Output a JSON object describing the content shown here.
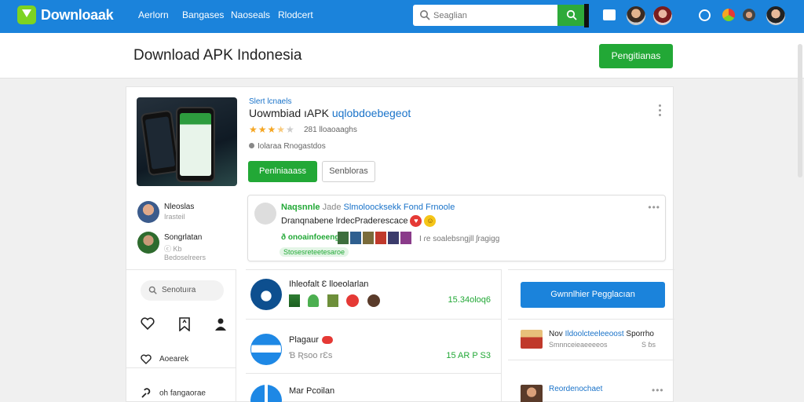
{
  "topbar": {
    "brand": "Downloaak",
    "nav": [
      "Aerlorn",
      "Bangases",
      "Naoseals",
      "Rlodcert"
    ],
    "search_placeholder": "Seaglian"
  },
  "header": {
    "title": "Download APK Indonesia",
    "button": "Pengitianas"
  },
  "app": {
    "category": "Slert lcnaels",
    "title_plain": "Uowmbiad ıAPK ",
    "title_link": "uqlobdoebegeot",
    "rating_stars": 3.5,
    "rating_text": "281 lloaoaaghs",
    "meta": "Iolaraa Rnogastdos",
    "primary_button": "Penlniaaass",
    "secondary_button": "Senbloras"
  },
  "users": [
    {
      "name": "Nleoslas",
      "sub": "Irasteil"
    },
    {
      "name": "Songrlatan",
      "sub": "ⓒ Kb",
      "sub2": "Bedoselreers"
    }
  ],
  "comment": {
    "author": "Naqsnnle",
    "separator": "Jade",
    "link": "Slmoloocksekk Fond Frnoole",
    "text": "Dranqnabene lrdecPraderescace",
    "tag": "ð onoainfoeeng",
    "tag_right": "Ι ɾe soalebsngjll ʃragigg",
    "pill": "Stosesreteetesaroe"
  },
  "left_panel": {
    "search_label": "Senotuıra",
    "link1": "Aoearek",
    "link2": "oh fangaorae"
  },
  "list": [
    {
      "title": "Ihleofalt Ɛ lloeolarlan",
      "size": "15.34oloq6"
    },
    {
      "title": "Plagaur",
      "sub": "Ɓ Ʀsoo rƐs",
      "size": "15 AR P S3"
    },
    {
      "title": "Mar Pcoilan"
    }
  ],
  "right_panel": {
    "button": "Gwnnlhier Pegglacıan",
    "item1_plain": "Nov ",
    "item1_link": "Ildoolcteeleeoost",
    "item1_right": "Sporrho",
    "item1_sub": "Smnnceieaeeeeos",
    "item1_sub_right": "S ɓs",
    "item2_link": "Reordenochaet"
  },
  "colors": {
    "topbar": "#1b83db",
    "accent_green": "#22a836",
    "link_blue": "#1a73c9"
  }
}
